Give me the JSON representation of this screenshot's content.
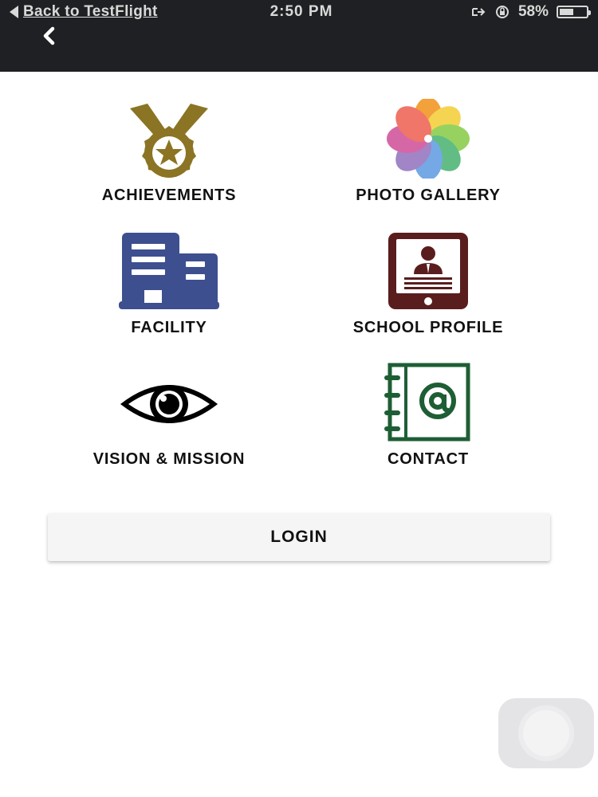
{
  "status_bar": {
    "back_app": "Back to TestFlight",
    "time": "2:50 PM",
    "battery": "58%",
    "battery_level": 0.58
  },
  "nav": {
    "back_icon": "chevron-left-icon"
  },
  "menu": [
    {
      "label": "ACHIEVEMENTS",
      "icon": "medal-icon",
      "color": "#8b7423"
    },
    {
      "label": "PHOTO GALLERY",
      "icon": "photos-flower-icon",
      "color": "#f4a340"
    },
    {
      "label": "FACILITY",
      "icon": "building-icon",
      "color": "#3d4f8f"
    },
    {
      "label": "SCHOOL PROFILE",
      "icon": "profile-tablet-icon",
      "color": "#5a1d1e"
    },
    {
      "label": "VISION & MISSION",
      "icon": "eye-icon",
      "color": "#000000"
    },
    {
      "label": "CONTACT",
      "icon": "address-book-icon",
      "color": "#1e5e34"
    }
  ],
  "login": {
    "label": "LOGIN"
  }
}
